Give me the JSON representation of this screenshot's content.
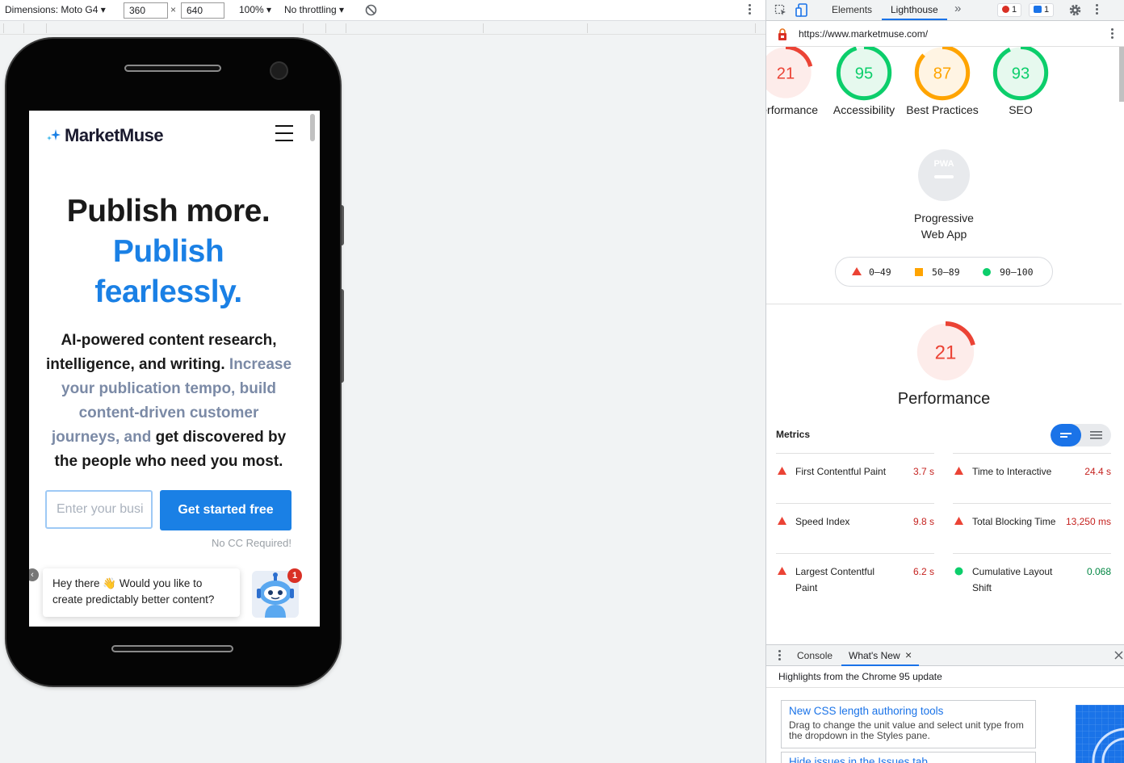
{
  "device_toolbar": {
    "dimensions_label": "Dimensions: Moto G4 ▾",
    "width_value": "360",
    "times": "×",
    "height_value": "640",
    "zoom": "100% ▾",
    "throttling": "No throttling ▾"
  },
  "site": {
    "brand": "MarketMuse",
    "hero_line1": "Publish more.",
    "hero_line2": "Publish",
    "hero_line3": "fearlessly.",
    "sub_dark": "AI-powered content research, intelligence, and writing.",
    "sub_muted": "Increase your publication tempo, build content-driven customer journeys, and",
    "sub_dark2": "get discovered by the people who need you most.",
    "email_placeholder": "Enter your busi",
    "cta": "Get started free",
    "no_cc": "No CC Required!",
    "chat_text": "Hey there 👋 Would you like to create predictably better content?",
    "chat_close": "‹",
    "chat_badge": "1"
  },
  "devtools": {
    "tabs": [
      "Elements",
      "Lighthouse"
    ],
    "more_tabs": "»",
    "errors_count": "1",
    "messages_count": "1",
    "url": "https://www.marketmuse.com/"
  },
  "lighthouse": {
    "scores": [
      {
        "label": "Performance",
        "value": 21,
        "color": "#eb4335"
      },
      {
        "label": "Accessibility",
        "value": 95,
        "color": "#0cce6b"
      },
      {
        "label": "Best Practices",
        "value": 87,
        "color": "#ffa400"
      },
      {
        "label": "SEO",
        "value": 93,
        "color": "#0cce6b"
      }
    ],
    "pwa_label": "Progressive Web App",
    "pwa_badge": "PWA",
    "legend": [
      {
        "range": "0–49",
        "shape": "triangle",
        "color": "#eb4335"
      },
      {
        "range": "50–89",
        "shape": "square",
        "color": "#ffa400"
      },
      {
        "range": "90–100",
        "shape": "circle",
        "color": "#0cce6b"
      }
    ],
    "performance_score": 21,
    "performance_title": "Performance",
    "metrics_label": "Metrics",
    "metrics": [
      {
        "name": "First Contentful Paint",
        "value": "3.7 s",
        "status": "fail"
      },
      {
        "name": "Time to Interactive",
        "value": "24.4 s",
        "status": "fail"
      },
      {
        "name": "Speed Index",
        "value": "9.8 s",
        "status": "fail"
      },
      {
        "name": "Total Blocking Time",
        "value": "13,250 ms",
        "status": "fail"
      },
      {
        "name": "Largest Contentful Paint",
        "value": "6.2 s",
        "status": "fail"
      },
      {
        "name": "Cumulative Layout Shift",
        "value": "0.068",
        "status": "pass"
      }
    ]
  },
  "drawer": {
    "tabs": [
      "Console",
      "What's New"
    ],
    "close_tab": "×",
    "highlights": "Highlights from the Chrome 95 update",
    "card1_title": "New CSS length authoring tools",
    "card1_desc": "Drag to change the unit value and select unit type from the dropdown in the Styles pane.",
    "card2_title": "Hide issues in the Issues tab"
  },
  "colors": {
    "brand_blue": "#1a80e5",
    "devtools_blue": "#1a73e8",
    "fail_red": "#eb4335",
    "pass_green": "#0cce6b"
  }
}
